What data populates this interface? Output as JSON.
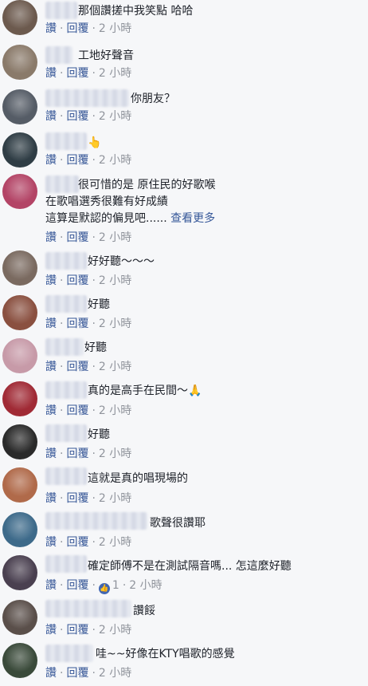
{
  "actions": {
    "like": "讚",
    "reply": "回覆",
    "separator": "·"
  },
  "comments": [
    {
      "lines": [
        "那個讚搓中我笑點 哈哈"
      ],
      "time": "2 小時",
      "avatar_color": "#6c5a4e"
    },
    {
      "lines": [
        "工地好聲音"
      ],
      "time": "2 小時",
      "avatar_color": "#8a7a6a"
    },
    {
      "lines": [
        "你朋友？"
      ],
      "time": "2 小時",
      "avatar_color": "#555c66"
    },
    {
      "lines": [
        "👆"
      ],
      "time": "2 小時",
      "avatar_color": "#2f3d45"
    },
    {
      "lines": [
        "很可惜的是 原住民的好歌喉",
        "在歌唱選秀很難有好成績",
        "這算是默認的偏見吧......"
      ],
      "more": "查看更多",
      "time": "2 小時",
      "avatar_color": "#b34466"
    },
    {
      "lines": [
        "好好聽～～～"
      ],
      "time": "2 小時",
      "avatar_color": "#7a6a60"
    },
    {
      "lines": [
        "好聽"
      ],
      "time": "2 小時",
      "avatar_color": "#8a5040"
    },
    {
      "lines": [
        "好聽"
      ],
      "time": "2 小時",
      "avatar_color": "#c79aa8"
    },
    {
      "lines": [
        "真的是高手在民間～🙏"
      ],
      "time": "2 小時",
      "avatar_color": "#a02a35"
    },
    {
      "lines": [
        "好聽"
      ],
      "time": "2 小時",
      "avatar_color": "#2a2a2a"
    },
    {
      "lines": [
        "這就是真的唱現場的"
      ],
      "time": "2 小時",
      "avatar_color": "#b06a4a"
    },
    {
      "lines": [
        "歌聲很讚耶"
      ],
      "time": "2 小時",
      "avatar_color": "#3d6a8a"
    },
    {
      "lines": [
        "確定師傅不是在測試隔音嗎... 怎這麼好聽"
      ],
      "time": "2 小時",
      "likes": "1",
      "avatar_color": "#4a4050"
    },
    {
      "lines": [
        "讚餒"
      ],
      "time": "2 小時",
      "avatar_color": "#5a4f4a"
    },
    {
      "lines": [
        "哇~~好像在KTY唱歌的感覺"
      ],
      "time": "2 小時",
      "avatar_color": "#3a4a3a"
    }
  ]
}
